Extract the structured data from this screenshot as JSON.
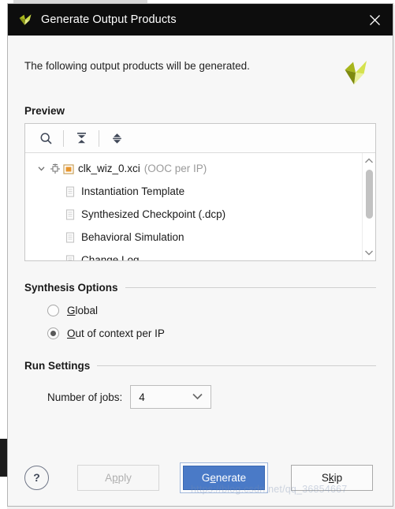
{
  "window": {
    "title": "Generate Output Products",
    "logo_icon": "vivado-logo-icon",
    "close_icon": "close-icon"
  },
  "intro": {
    "text": "The following output products will be generated.",
    "brand_icon": "xilinx-logo-icon"
  },
  "preview": {
    "section_title": "Preview",
    "toolbar": [
      {
        "name": "search-icon",
        "tooltip": "Search"
      },
      {
        "name": "collapse-all-icon",
        "tooltip": "Collapse All"
      },
      {
        "name": "expand-all-icon",
        "tooltip": "Expand All"
      }
    ],
    "tree": {
      "root": {
        "label": "clk_wiz_0.xci",
        "suffix": "(OOC per IP)",
        "expanded": true,
        "twisty_icon": "chevron-down-icon",
        "ip_icon": "ip-core-icon",
        "status_icon": "orange-square-icon"
      },
      "children": [
        {
          "label": "Instantiation Template",
          "icon": "document-icon"
        },
        {
          "label": "Synthesized Checkpoint (.dcp)",
          "icon": "document-icon"
        },
        {
          "label": "Behavioral Simulation",
          "icon": "document-icon"
        },
        {
          "label": "Change Log",
          "icon": "document-icon"
        }
      ]
    },
    "scrollbar": {
      "up_icon": "chevron-up-icon",
      "down_icon": "chevron-down-icon"
    }
  },
  "synthesis_options": {
    "section_title": "Synthesis Options",
    "options": [
      {
        "label_pre": "",
        "mnemonic": "G",
        "label_post": "lobal",
        "selected": false
      },
      {
        "label_pre": "",
        "mnemonic": "O",
        "label_post": "ut of context per IP",
        "selected": true
      }
    ]
  },
  "run_settings": {
    "section_title": "Run Settings",
    "jobs_label": "Number of jobs:",
    "jobs_value": "4",
    "jobs_chevron_icon": "chevron-down-icon"
  },
  "footer": {
    "help_label": "?",
    "apply_pre": "A",
    "apply_mnemonic": "p",
    "apply_post": "ply",
    "apply_label": "Apply",
    "apply_enabled": false,
    "generate_pre": "G",
    "generate_mnemonic": "e",
    "generate_post": "nerate",
    "generate_label": "Generate",
    "generate_default": true,
    "skip_pre": "S",
    "skip_mnemonic": "k",
    "skip_post": "ip",
    "skip_label": "Skip"
  },
  "watermark": {
    "text": "https://blog.csdn.net/qq_36854667"
  },
  "colors": {
    "titlebar_bg": "#0d0d0d",
    "dialog_bg": "#f7f7f7",
    "accent_blue": "#4a7ac7",
    "tree_muted": "#9a9a9a",
    "orange_status": "#e8962e"
  }
}
